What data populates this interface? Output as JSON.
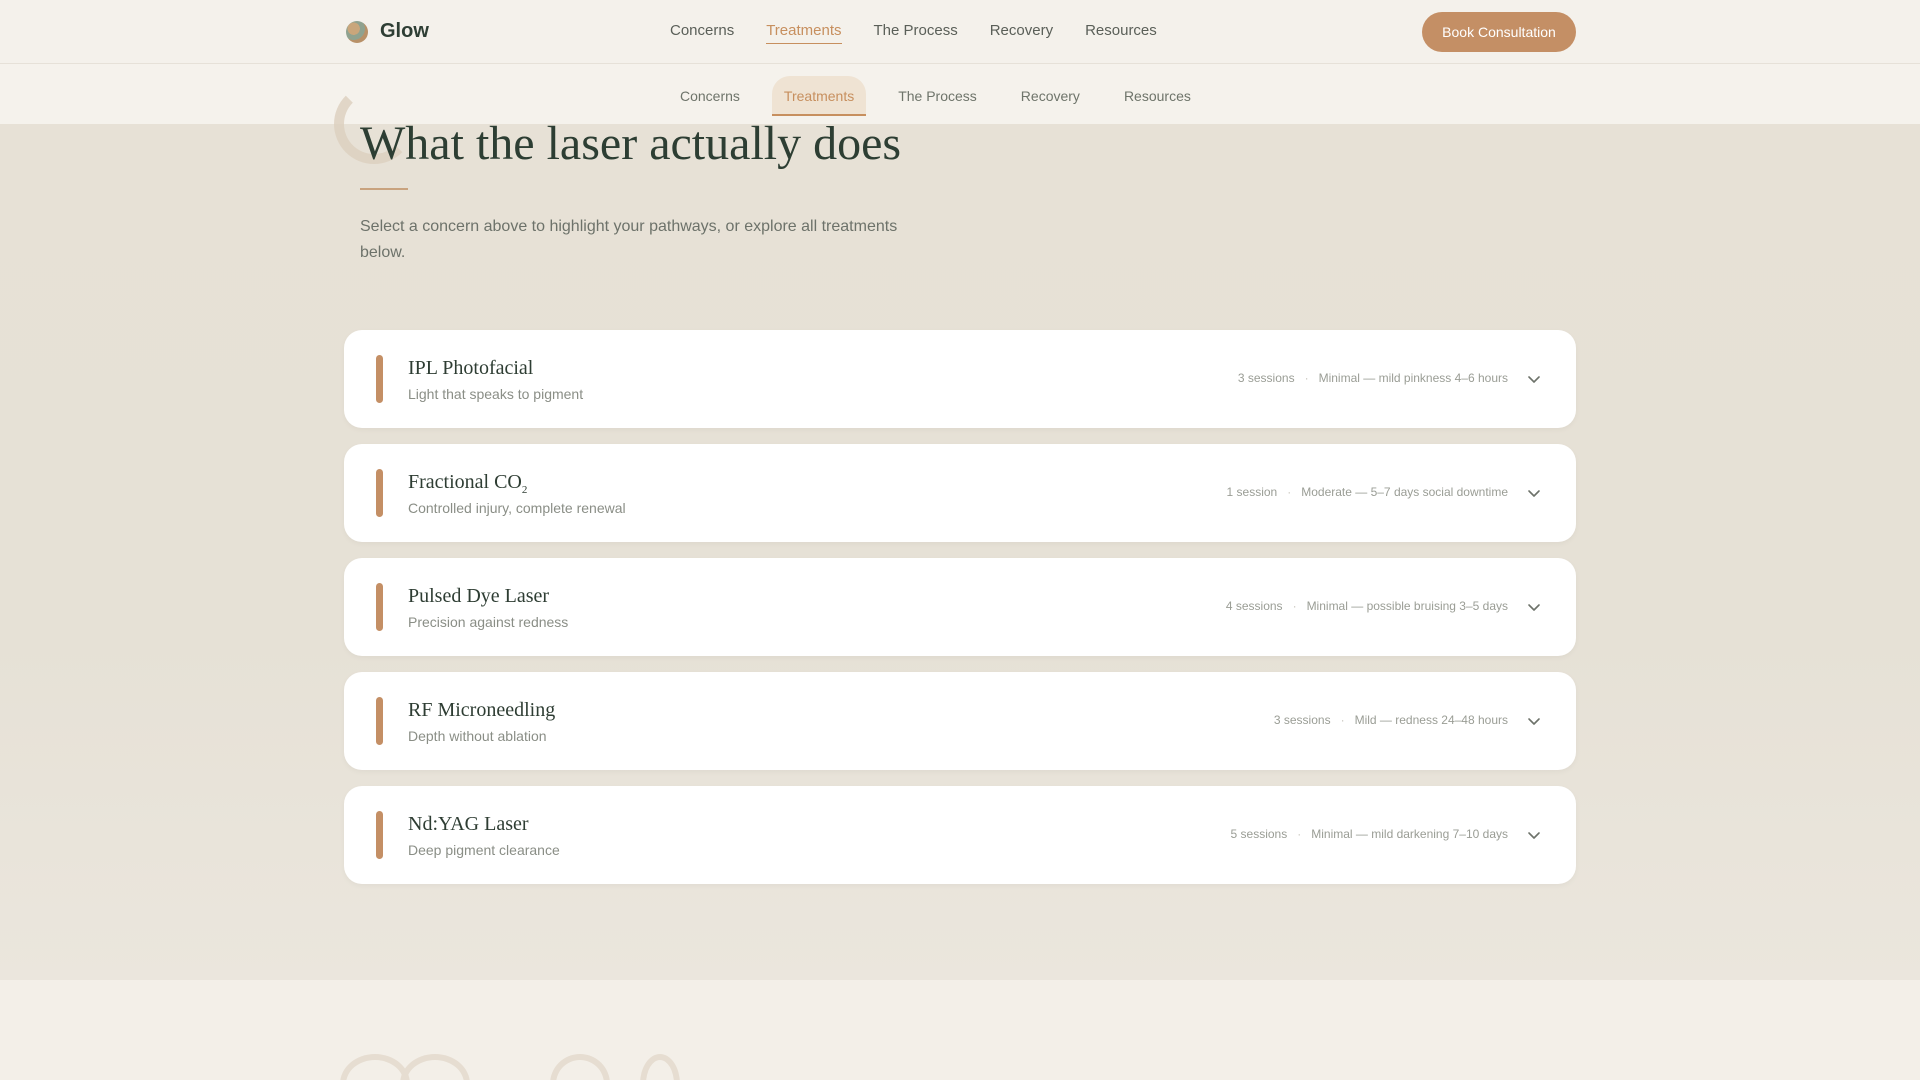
{
  "brand": {
    "name": "Glow",
    "logo_icon": "glow-logo-icon"
  },
  "header": {
    "nav": [
      {
        "label": "Concerns",
        "active": false
      },
      {
        "label": "Treatments",
        "active": true
      },
      {
        "label": "The Process",
        "active": false
      },
      {
        "label": "Recovery",
        "active": false
      },
      {
        "label": "Resources",
        "active": false
      }
    ],
    "cta_label": "Book Consultation"
  },
  "subnav": [
    {
      "label": "Concerns",
      "active": false
    },
    {
      "label": "Treatments",
      "active": true
    },
    {
      "label": "The Process",
      "active": false
    },
    {
      "label": "Recovery",
      "active": false
    },
    {
      "label": "Resources",
      "active": false
    }
  ],
  "section": {
    "title": "What the laser actually does",
    "lead": "Select a concern above to highlight your pathways, or explore all treatments below."
  },
  "treatments": [
    {
      "title": "IPL Photofacial",
      "title_sub": "",
      "subtitle": "Light that speaks to pigment",
      "sessions": "3 sessions",
      "downtime": "Minimal — mild pinkness 4–6 hours"
    },
    {
      "title": "Fractional CO",
      "title_sub": "2",
      "subtitle": "Controlled injury, complete renewal",
      "sessions": "1 session",
      "downtime": "Moderate — 5–7 days social downtime"
    },
    {
      "title": "Pulsed Dye Laser",
      "title_sub": "",
      "subtitle": "Precision against redness",
      "sessions": "4 sessions",
      "downtime": "Minimal — possible bruising 3–5 days"
    },
    {
      "title": "RF Microneedling",
      "title_sub": "",
      "subtitle": "Depth without ablation",
      "sessions": "3 sessions",
      "downtime": "Mild — redness 24–48 hours"
    },
    {
      "title": "Nd:YAG Laser",
      "title_sub": "",
      "subtitle": "Deep pigment clearance",
      "sessions": "5 sessions",
      "downtime": "Minimal — mild darkening 7–10 days"
    }
  ],
  "colors": {
    "accent": "#c48f65",
    "heading": "#2d3e33",
    "background": "#f3efe8"
  },
  "icons": {
    "expand": "chevron-down-icon"
  }
}
